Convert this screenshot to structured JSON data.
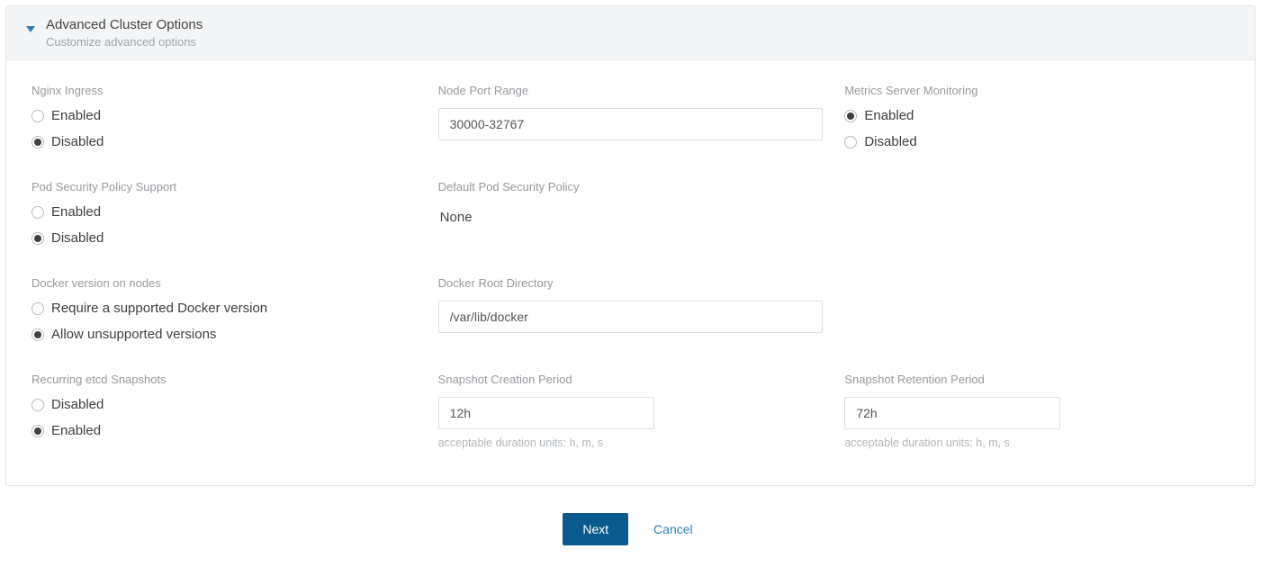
{
  "header": {
    "title": "Advanced Cluster Options",
    "subtitle": "Customize advanced options"
  },
  "nginx": {
    "label": "Nginx Ingress",
    "opt_enabled": "Enabled",
    "opt_disabled": "Disabled",
    "selected": "disabled"
  },
  "node_port": {
    "label": "Node Port Range",
    "value": "30000-32767"
  },
  "metrics": {
    "label": "Metrics Server Monitoring",
    "opt_enabled": "Enabled",
    "opt_disabled": "Disabled",
    "selected": "enabled"
  },
  "pod_security": {
    "label": "Pod Security Policy Support",
    "opt_enabled": "Enabled",
    "opt_disabled": "Disabled",
    "selected": "disabled"
  },
  "default_pod_policy": {
    "label": "Default Pod Security Policy",
    "value": "None"
  },
  "docker_version": {
    "label": "Docker version on nodes",
    "opt_require": "Require a supported Docker version",
    "opt_allow": "Allow unsupported versions",
    "selected": "allow"
  },
  "docker_root": {
    "label": "Docker Root Directory",
    "value": "/var/lib/docker"
  },
  "snapshots": {
    "label": "Recurring etcd Snapshots",
    "opt_disabled": "Disabled",
    "opt_enabled": "Enabled",
    "selected": "enabled"
  },
  "snap_create": {
    "label": "Snapshot Creation Period",
    "value": "12h",
    "help": "acceptable duration units: h, m, s"
  },
  "snap_retain": {
    "label": "Snapshot Retention Period",
    "value": "72h",
    "help": "acceptable duration units: h, m, s"
  },
  "actions": {
    "next": "Next",
    "cancel": "Cancel"
  }
}
